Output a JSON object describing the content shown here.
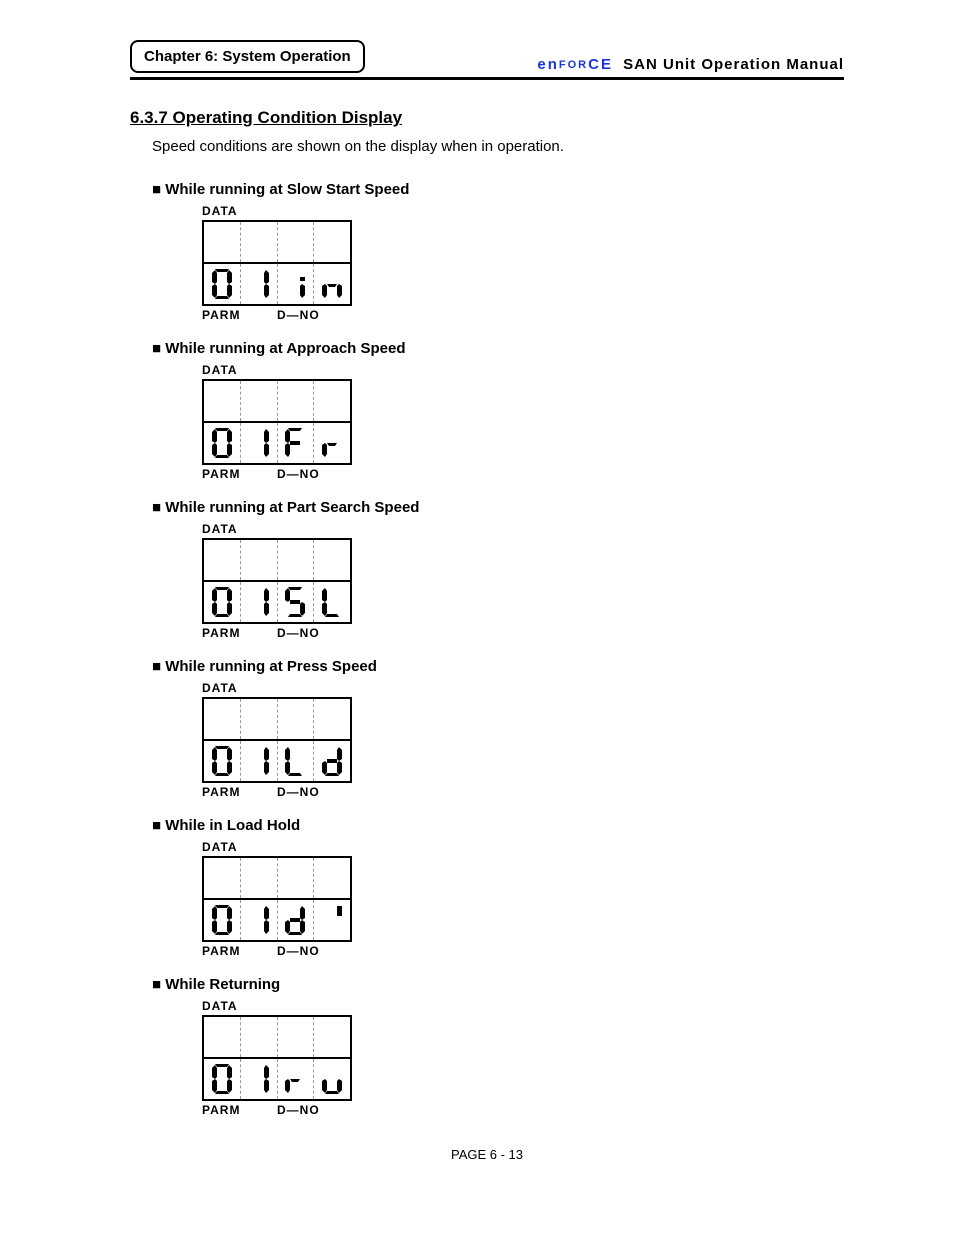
{
  "header": {
    "chapter": "Chapter 6: System Operation",
    "logo_left": "en",
    "logo_mid": "FOR",
    "logo_right": "CE",
    "manual": " SAN  Unit  Operation  Manual"
  },
  "section": {
    "number": "6.3.7   Operating Condition Display",
    "intro": "Speed conditions are shown on the display when in operation."
  },
  "conditions": [
    {
      "title": "■ While running at Slow Start Speed",
      "digits": [
        "0",
        "1",
        "i",
        "n"
      ]
    },
    {
      "title": "■ While running at Approach Speed",
      "digits": [
        "0",
        "1",
        "F",
        "r"
      ]
    },
    {
      "title": "■ While running at Part Search Speed",
      "digits": [
        "0",
        "1",
        "5",
        "L"
      ]
    },
    {
      "title": "■ While running at Press Speed",
      "digits": [
        "0",
        "1",
        "L",
        "d"
      ]
    },
    {
      "title": "■ While in Load Hold",
      "digits": [
        "0",
        "1",
        "d",
        "'"
      ]
    },
    {
      "title": "■ While Returning",
      "digits": [
        "0",
        "1",
        "r",
        "u"
      ]
    }
  ],
  "fig_labels": {
    "top": "DATA",
    "bot_left": "PARM",
    "bot_right": "D—NO"
  },
  "footer": "PAGE 6 - 13"
}
